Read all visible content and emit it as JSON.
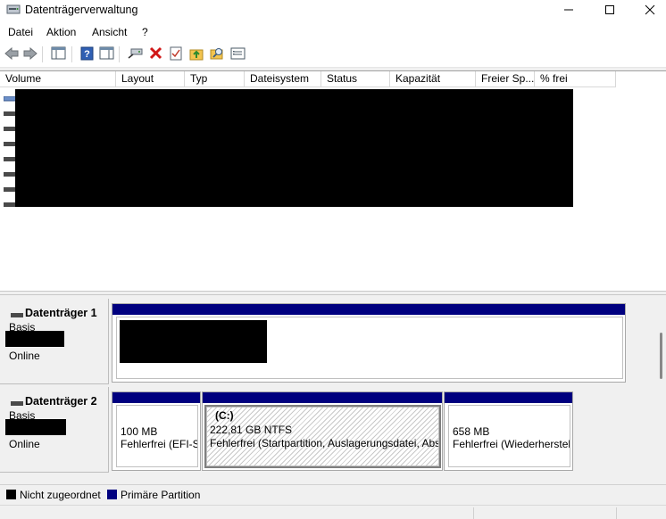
{
  "window": {
    "title": "Datenträgerverwaltung",
    "controls": {
      "minimize": "minimize-icon",
      "maximize": "maximize-icon",
      "close": "close-icon"
    }
  },
  "menu": [
    "Datei",
    "Aktion",
    "Ansicht",
    "?"
  ],
  "toolbar": {
    "icons": [
      "back-arrow-icon",
      "forward-arrow-icon",
      "console-tree-icon",
      "help-icon",
      "properties-pane-icon",
      "connect-drive-icon",
      "delete-icon",
      "checklist-icon",
      "folder-up-icon",
      "search-folder-icon",
      "properties-icon"
    ]
  },
  "volume_list": {
    "columns": [
      "Volume",
      "Layout",
      "Typ",
      "Dateisystem",
      "Status",
      "Kapazität",
      "Freier Sp...",
      "% frei"
    ]
  },
  "disks": [
    {
      "name": "Datenträger 1",
      "type": "Basis",
      "status": "Online",
      "partitions": []
    },
    {
      "name": "Datenträger 2",
      "type": "Basis",
      "status": "Online",
      "partitions": [
        {
          "label": "",
          "size": "100 MB",
          "status": "Fehlerfrei (EFI-Sy"
        },
        {
          "label": "(C:)",
          "size": "222,81 GB NTFS",
          "status": "Fehlerfrei (Startpartition, Auslagerungsdatei, Abs"
        },
        {
          "label": "",
          "size": "658 MB",
          "status": "Fehlerfrei (Wiederherstel"
        }
      ]
    }
  ],
  "legend": {
    "unallocated": "Nicht zugeordnet",
    "primary": "Primäre Partition"
  },
  "colors": {
    "unallocated": "#000000",
    "primary": "#00007f"
  }
}
